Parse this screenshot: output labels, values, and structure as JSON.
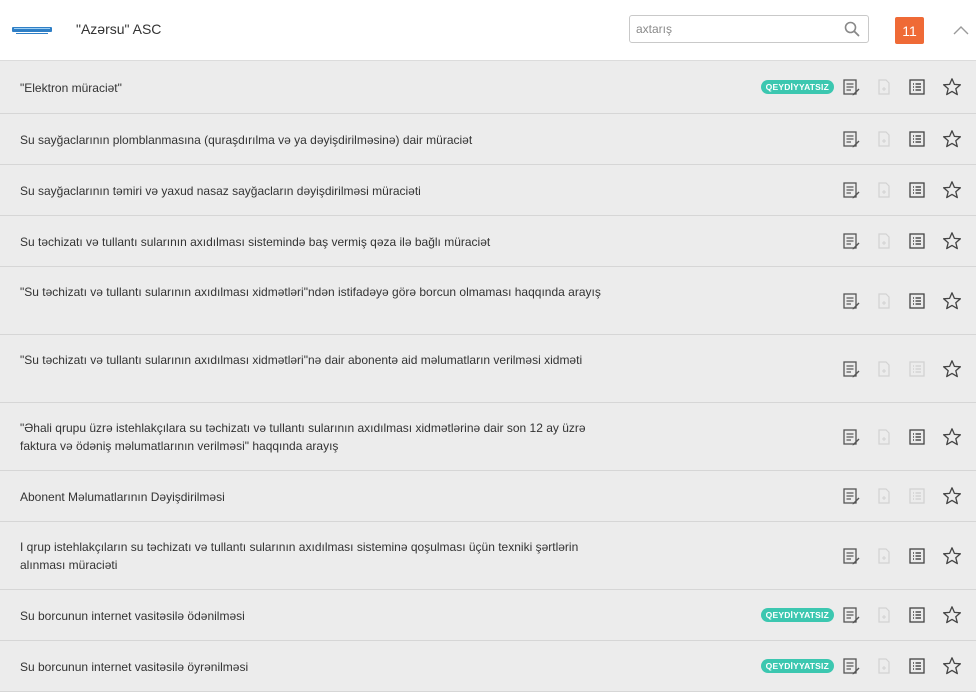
{
  "header": {
    "org_title": "\"Azərsu\" ASC",
    "search_placeholder": "axtarış",
    "count": "11"
  },
  "badge_text": "QEYDİYYATSIZ",
  "colors": {
    "accent": "#ef6a36",
    "badge": "#3cc7b0",
    "row_bg": "#ececec"
  },
  "services": [
    {
      "title": "\"Elektron müraciət\"",
      "unregistered": true,
      "pdf_enabled": false,
      "list_enabled": true
    },
    {
      "title": "Su sayğaclarının plomblanmasına (quraşdırılma və ya dəyişdirilməsinə) dair müraciət",
      "unregistered": false,
      "pdf_enabled": false,
      "list_enabled": true
    },
    {
      "title": "Su sayğaclarının təmiri və yaxud nasaz sayğacların dəyişdirilməsi müraciəti",
      "unregistered": false,
      "pdf_enabled": false,
      "list_enabled": true
    },
    {
      "title": "Su təchizatı və tullantı sularının axıdılması sistemində baş vermiş qəza ilə bağlı müraciət",
      "unregistered": false,
      "pdf_enabled": false,
      "list_enabled": true
    },
    {
      "title": "\"Su təchizatı və tullantı sularının axıdılması xidmətləri\"ndən istifadəyə görə borcun olmaması haqqında arayış",
      "unregistered": false,
      "pdf_enabled": false,
      "list_enabled": true
    },
    {
      "title": "\"Su təchizatı və tullantı sularının axıdılması xidmətləri\"nə dair abonentə aid məlumatların verilməsi xidməti",
      "unregistered": false,
      "pdf_enabled": false,
      "list_enabled": false
    },
    {
      "title": "\"Əhali qrupu üzrə istehlakçılara su təchizatı və tullantı sularının axıdılması xidmətlərinə dair son 12 ay üzrə faktura və ödəniş məlumatlarının verilməsi\" haqqında arayış",
      "unregistered": false,
      "pdf_enabled": false,
      "list_enabled": true
    },
    {
      "title": "Abonent Məlumatlarının Dəyişdirilməsi",
      "unregistered": false,
      "pdf_enabled": false,
      "list_enabled": false
    },
    {
      "title": "I qrup istehlakçıların su təchizatı və tullantı sularının axıdılması sisteminə qoşulması üçün texniki şərtlərin alınması müraciəti",
      "unregistered": false,
      "pdf_enabled": false,
      "list_enabled": true
    },
    {
      "title": "Su borcunun internet vasitəsilə ödənilməsi",
      "unregistered": true,
      "pdf_enabled": false,
      "list_enabled": true
    },
    {
      "title": "Su borcunun internet vasitəsilə öyrənilməsi",
      "unregistered": true,
      "pdf_enabled": false,
      "list_enabled": true
    }
  ]
}
